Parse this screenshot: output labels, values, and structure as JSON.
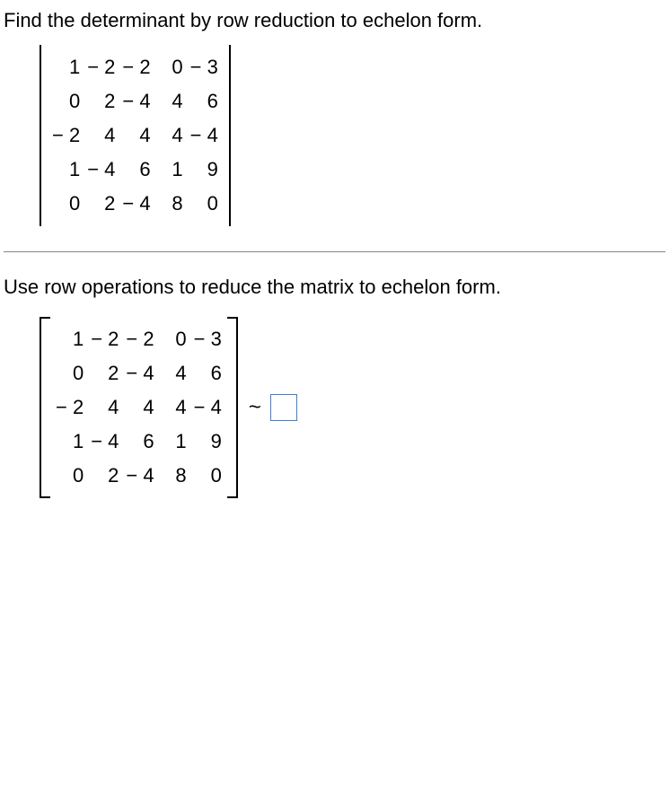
{
  "question": "Find the determinant by row reduction to echelon form.",
  "instruction": "Use row operations to reduce the matrix to echelon form.",
  "tilde": "~",
  "matrix1": {
    "r0": {
      "c0": "1",
      "c1": "− 2",
      "c2": "− 2",
      "c3": "0",
      "c4": "− 3"
    },
    "r1": {
      "c0": "0",
      "c1": "2",
      "c2": "− 4",
      "c3": "4",
      "c4": "6"
    },
    "r2": {
      "c0": "− 2",
      "c1": "4",
      "c2": "4",
      "c3": "4",
      "c4": "− 4"
    },
    "r3": {
      "c0": "1",
      "c1": "− 4",
      "c2": "6",
      "c3": "1",
      "c4": "9"
    },
    "r4": {
      "c0": "0",
      "c1": "2",
      "c2": "− 4",
      "c3": "8",
      "c4": "0"
    }
  },
  "matrix2": {
    "r0": {
      "c0": "1",
      "c1": "− 2",
      "c2": "− 2",
      "c3": "0",
      "c4": "− 3"
    },
    "r1": {
      "c0": "0",
      "c1": "2",
      "c2": "− 4",
      "c3": "4",
      "c4": "6"
    },
    "r2": {
      "c0": "− 2",
      "c1": "4",
      "c2": "4",
      "c3": "4",
      "c4": "− 4"
    },
    "r3": {
      "c0": "1",
      "c1": "− 4",
      "c2": "6",
      "c3": "1",
      "c4": "9"
    },
    "r4": {
      "c0": "0",
      "c1": "2",
      "c2": "− 4",
      "c3": "8",
      "c4": "0"
    }
  }
}
